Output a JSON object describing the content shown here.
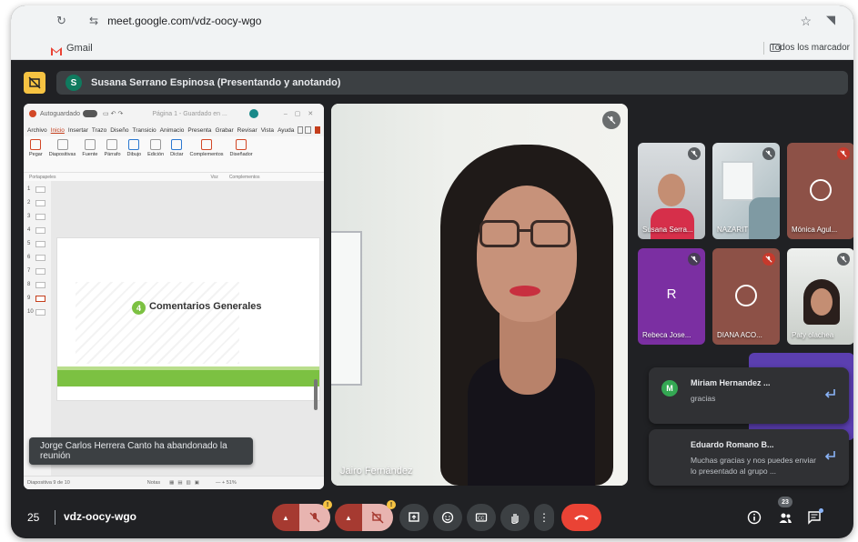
{
  "browser": {
    "url": "meet.google.com/vdz-oocy-wgo",
    "bookmark_gmail": "Gmail",
    "bookmark_all": "Todos los marcador"
  },
  "presenter": {
    "initial": "S",
    "label": "Susana Serrano Espinosa (Presentando y anotando)"
  },
  "ppt": {
    "autosave": "Autoguardado",
    "file_title": "Página 1 - Guardado en ...",
    "menu": [
      "Archivo",
      "Inicio",
      "Insertar",
      "Trazo",
      "Diseño",
      "Transicio",
      "Animacio",
      "Presenta",
      "Grabar",
      "Revisar",
      "Vista",
      "Ayuda"
    ],
    "ribbon": [
      "Pegar",
      "Diapositivas",
      "Fuente",
      "Párrafo",
      "Dibujo",
      "Edición",
      "Dictar",
      "Complementos",
      "Diseñador"
    ],
    "groups": [
      "Portapapeles",
      "Voz",
      "Complementos"
    ],
    "slide_numbers": [
      "1",
      "2",
      "3",
      "4",
      "5",
      "6",
      "7",
      "8",
      "9",
      "10"
    ],
    "slide_badge": "4",
    "slide_title": "Comentarios Generales",
    "status_left": "Diapositiva 9 de 10",
    "status_notes": "Notas",
    "status_zoom": "— + 51%"
  },
  "toast": "Jorge Carlos Herrera Canto ha abandonado la reunión",
  "speaker": {
    "name": "Jairo Fernández"
  },
  "tiles": [
    {
      "name": "Susana Serra...",
      "mic": "gray"
    },
    {
      "name": "NAZARIT",
      "mic": "gray"
    },
    {
      "name": "Mónica Agul...",
      "mic": "red"
    },
    {
      "name": "Rebeca Jose...",
      "initial": "R",
      "mic": "gray"
    },
    {
      "name": "DIANA ACO...",
      "mic": "red"
    },
    {
      "name": "Paty olachea",
      "mic": "gray"
    }
  ],
  "chats": [
    {
      "initial": "M",
      "name": "Miriam Hernandez ...",
      "message": "gracias"
    },
    {
      "initial": "",
      "name": "Eduardo Romano B...",
      "message": "Muchas gracias y nos puedes enviar lo presentado al grupo ..."
    }
  ],
  "bottom": {
    "time": "25",
    "meeting_code": "vdz-oocy-wgo",
    "people_count": "23"
  },
  "colors": {
    "meet_bg": "#202124",
    "end_call": "#ea4335",
    "accent_green": "#7cc142",
    "presenter_avatar": "#0f7b5f"
  }
}
